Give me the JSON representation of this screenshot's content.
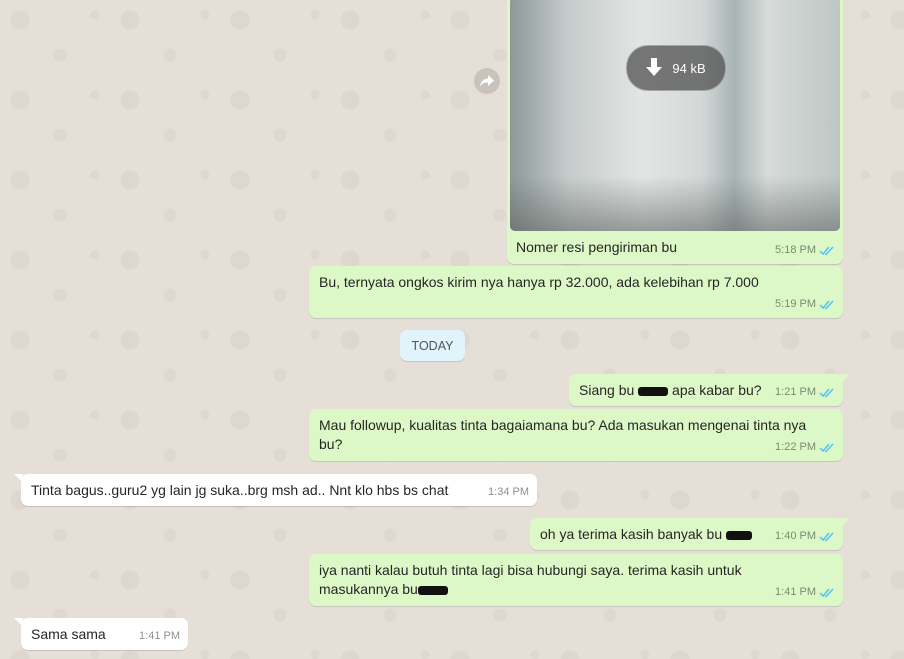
{
  "media": {
    "download_size": "94 kB",
    "caption": "Nomer resi pengiriman bu",
    "time": "5:18 PM"
  },
  "messages": [
    {
      "text": "Bu, ternyata ongkos kirim nya hanya rp 32.000, ada kelebihan rp 7.000",
      "time": "5:19 PM"
    },
    {
      "text_before": "Siang bu ",
      "text_after": " apa kabar bu?",
      "time": "1:21 PM"
    },
    {
      "text": "Mau followup, kualitas tinta bagaiamana bu? Ada masukan mengenai tinta nya bu?",
      "time": "1:22 PM"
    },
    {
      "text": "Tinta bagus..guru2 yg lain jg suka..brg msh ad.. Nnt klo hbs bs chat",
      "time": "1:34 PM"
    },
    {
      "text": "oh ya terima kasih banyak bu ",
      "time": "1:40 PM"
    },
    {
      "text": "iya nanti kalau butuh tinta lagi bisa hubungi saya. terima kasih untuk masukannya bu",
      "time": "1:41 PM"
    },
    {
      "text": "Sama sama",
      "time": "1:41 PM"
    }
  ],
  "day_divider": "TODAY",
  "colors": {
    "outgoing": "#dcf8c6",
    "incoming": "#ffffff",
    "read_ticks": "#4fc3f7",
    "divider_bg": "#e1f3fb"
  },
  "icons": [
    "forward-icon",
    "download-icon",
    "double-check-icon"
  ]
}
